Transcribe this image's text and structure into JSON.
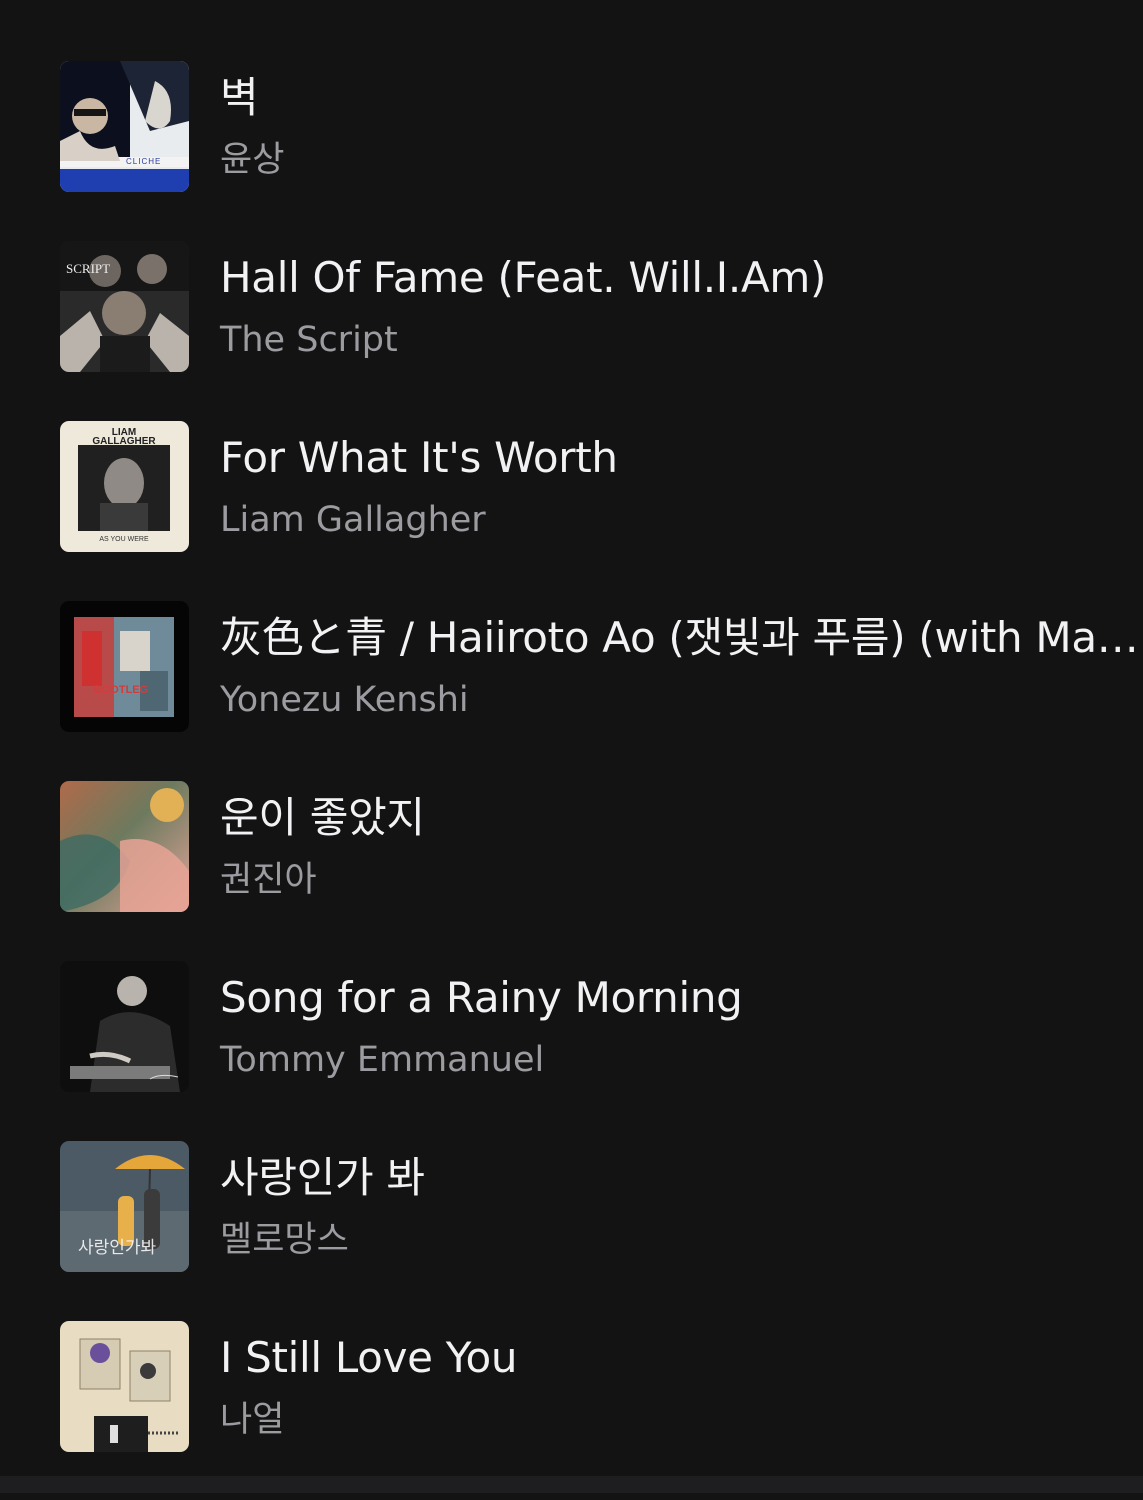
{
  "songs": [
    {
      "title": "벽",
      "artist": "윤상",
      "artwork_icon": "album-art-wall-icon"
    },
    {
      "title": "Hall Of Fame (Feat. Will.I.Am)",
      "artist": "The Script",
      "artwork_icon": "album-art-hall-of-fame-icon"
    },
    {
      "title": "For What It's Worth",
      "artist": "Liam Gallagher",
      "artwork_icon": "album-art-as-you-were-icon"
    },
    {
      "title": "灰色と青 / Haiiroto Ao (잿빛과 푸름) (with Mas…",
      "artist": "Yonezu Kenshi",
      "artwork_icon": "album-art-bootleg-icon"
    },
    {
      "title": "운이 좋았지",
      "artist": "권진아",
      "artwork_icon": "album-art-lucky-icon"
    },
    {
      "title": "Song for a Rainy Morning",
      "artist": "Tommy Emmanuel",
      "artwork_icon": "album-art-rainy-morning-icon"
    },
    {
      "title": "사랑인가 봐",
      "artist": "멜로망스",
      "artwork_icon": "album-art-love-maybe-icon"
    },
    {
      "title": "I Still Love You",
      "artist": "나얼",
      "artwork_icon": "album-art-still-love-you-icon"
    }
  ],
  "artwork_text": {
    "cliche": "CLICHE",
    "script": "SCRIPT",
    "liam_line1": "LIAM",
    "liam_line2": "GALLAGHER",
    "as_you_were": "AS YOU WERE",
    "bootleg": "BOOTLEG",
    "love_script": "사랑인가봐"
  },
  "colors": {
    "background": "#131314",
    "title": "#f2f2f4",
    "artist": "#9b9ba0"
  }
}
